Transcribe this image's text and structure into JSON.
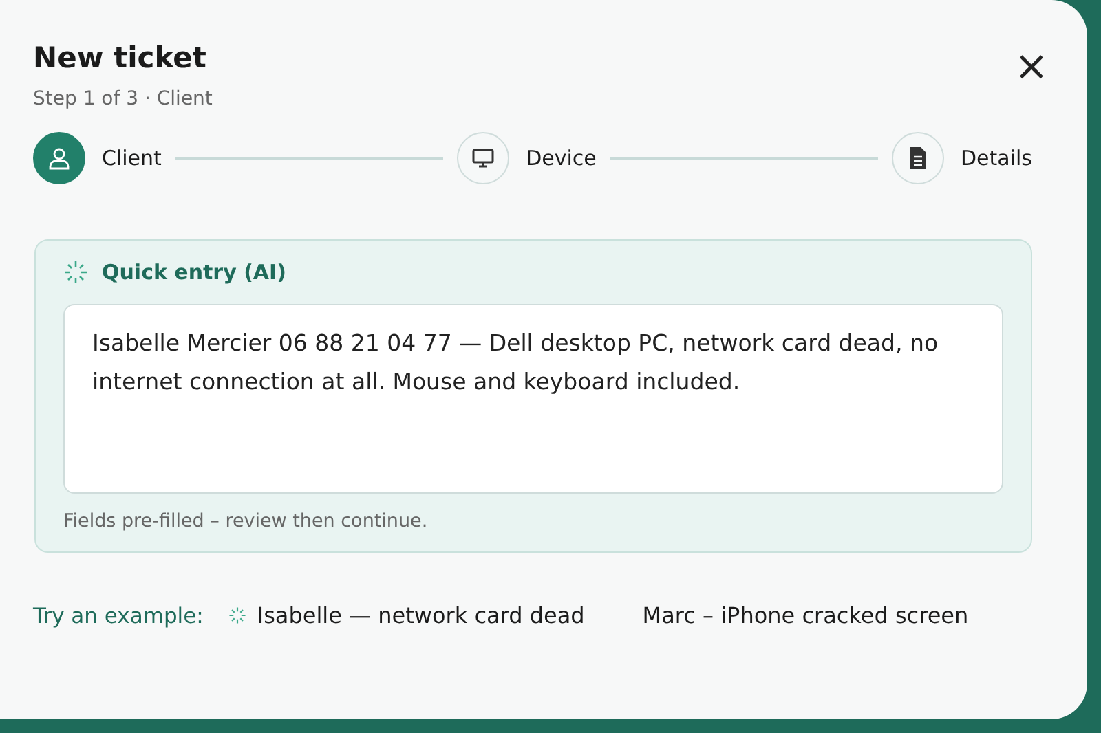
{
  "dialog": {
    "title": "New ticket",
    "subtitle": "Step 1 of 3 · Client",
    "close": "×"
  },
  "steps": [
    {
      "label": "Client",
      "kind": "person",
      "selected": true
    },
    {
      "label": "Device",
      "kind": "monitor",
      "selected": false
    },
    {
      "label": "Details",
      "kind": "document",
      "selected": false
    }
  ],
  "quick_entry": {
    "title": "Quick entry (AI)",
    "value": "Isabelle Mercier 06 88 21 04 77 — Dell desktop PC, network card dead, no internet connection at all. Mouse and keyboard included.",
    "hint": "Fields pre-filled – review then continue."
  },
  "examples": {
    "label": "Try an example:",
    "items": [
      {
        "label": "Isabelle — network card dead",
        "selected": true
      },
      {
        "label": "Marc – iPhone cracked screen",
        "selected": false
      }
    ]
  }
}
